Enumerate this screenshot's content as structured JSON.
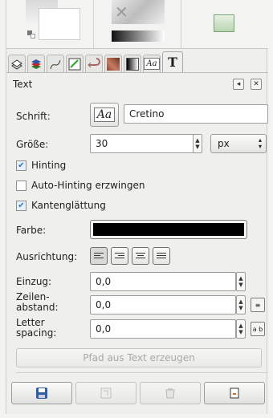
{
  "tabs": [
    {
      "name": "layers-icon"
    },
    {
      "name": "channels-icon"
    },
    {
      "name": "paths-icon"
    },
    {
      "name": "colormap-icon"
    },
    {
      "name": "undo-history-icon"
    },
    {
      "name": "patterns-icon"
    },
    {
      "name": "gradients-icon"
    },
    {
      "name": "fonts-icon"
    },
    {
      "name": "text-tool-icon",
      "label": "T"
    }
  ],
  "header": {
    "title": "Text"
  },
  "fields": {
    "font_label": "Schrift:",
    "font_value": "Cretino",
    "size_label": "Größe:",
    "size_value": "30",
    "unit_value": "px",
    "hinting": "Hinting",
    "autohint": "Auto-Hinting erzwingen",
    "antialias": "Kantenglättung",
    "color_label": "Farbe:",
    "justify_label": "Ausrichtung:",
    "indent_label": "Einzug:",
    "indent_value": "0,0",
    "line_spacing_label_1": "Zeilen-",
    "line_spacing_label_2": "abstand:",
    "line_spacing_value": "0,0",
    "letter_spacing_label_1": "Letter",
    "letter_spacing_label_2": "spacing:",
    "letter_spacing_value": "0,0",
    "path_button": "Pfad aus Text erzeugen",
    "colors": {
      "text_color": "#000000"
    }
  },
  "states": {
    "hinting": true,
    "autohint": false,
    "antialias": true
  }
}
